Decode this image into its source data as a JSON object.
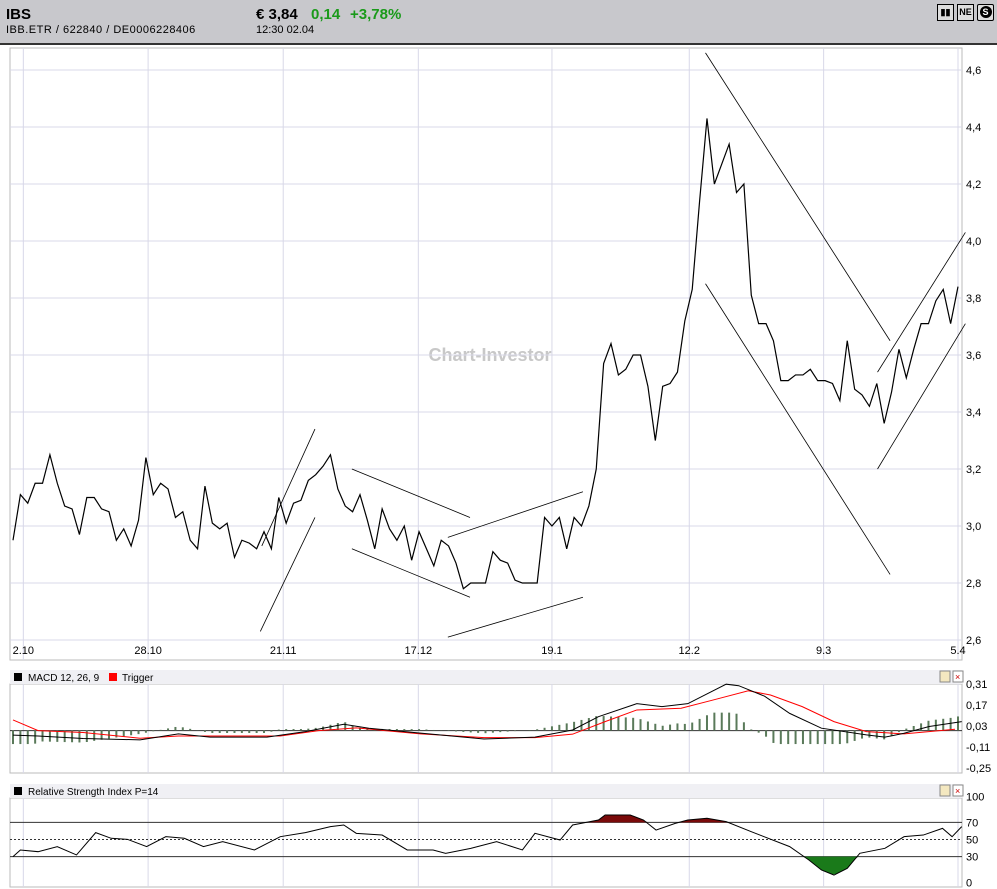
{
  "header": {
    "symbol": "IBS",
    "ids": "IBB.ETR  /  622840  /  DE0006228406",
    "price": "€ 3,84",
    "change": "0,14",
    "change_pct": "+3,78%",
    "time": "12:30   02.04",
    "icons": [
      "bar-chart-icon",
      "news-icon",
      "s-icon"
    ],
    "icon_labels": {
      "news": "NE"
    }
  },
  "watermark": "Chart-Investor",
  "chart_data": [
    {
      "type": "line",
      "title": "IBS price",
      "ylim": [
        2.6,
        4.6
      ],
      "yticks": [
        "4,6",
        "4,4",
        "4,2",
        "4,0",
        "3,8",
        "3,6",
        "3,4",
        "3,2",
        "3,0",
        "2,8",
        "2,6"
      ],
      "ytick_values": [
        4.6,
        4.4,
        4.2,
        4.0,
        3.8,
        3.6,
        3.4,
        3.2,
        3.0,
        2.8,
        2.6
      ],
      "xticks": [
        {
          "label": "2.10",
          "i": 1.4
        },
        {
          "label": "28.10",
          "i": 18.3
        },
        {
          "label": "21.11",
          "i": 36.6
        },
        {
          "label": "17.12",
          "i": 54.9
        },
        {
          "label": "19.1",
          "i": 73
        },
        {
          "label": "12.2",
          "i": 91.6
        },
        {
          "label": "9.3",
          "i": 109.8
        },
        {
          "label": "5.4",
          "i": 128
        }
      ],
      "values": [
        2.95,
        3.11,
        3.08,
        3.15,
        3.15,
        3.25,
        3.15,
        3.07,
        3.06,
        2.97,
        3.1,
        3.1,
        3.06,
        3.05,
        2.95,
        2.99,
        2.93,
        3.02,
        3.24,
        3.11,
        3.15,
        3.13,
        3.03,
        3.05,
        2.95,
        2.92,
        3.14,
        3.01,
        2.99,
        3.01,
        2.89,
        2.95,
        2.94,
        2.92,
        2.98,
        2.92,
        3.1,
        3.01,
        3.08,
        3.09,
        3.16,
        3.18,
        3.21,
        3.25,
        3.13,
        3.07,
        3.05,
        3.11,
        3.02,
        2.92,
        3.06,
        2.99,
        2.95,
        3.0,
        2.88,
        2.98,
        2.92,
        2.86,
        2.95,
        2.93,
        2.87,
        2.78,
        2.8,
        2.8,
        2.8,
        2.91,
        2.88,
        2.87,
        2.81,
        2.8,
        2.8,
        2.8,
        3.03,
        3.0,
        3.03,
        2.92,
        3.03,
        3.0,
        3.07,
        3.2,
        3.57,
        3.64,
        3.53,
        3.55,
        3.6,
        3.6,
        3.49,
        3.3,
        3.49,
        3.5,
        3.54,
        3.72,
        3.83,
        4.14,
        4.43,
        4.2,
        4.27,
        4.34,
        4.17,
        4.2,
        3.81,
        3.71,
        3.71,
        3.65,
        3.51,
        3.51,
        3.53,
        3.53,
        3.55,
        3.51,
        3.51,
        3.5,
        3.44,
        3.65,
        3.48,
        3.46,
        3.42,
        3.5,
        3.36,
        3.47,
        3.62,
        3.52,
        3.62,
        3.71,
        3.71,
        3.79,
        3.83,
        3.71,
        3.84
      ],
      "trendlines": [
        [
          33.5,
          2.63,
          40.9,
          3.03
        ],
        [
          33.7,
          2.93,
          40.9,
          3.34
        ],
        [
          45.9,
          3.2,
          61.9,
          3.03
        ],
        [
          45.9,
          2.92,
          61.9,
          2.75
        ],
        [
          58.9,
          2.96,
          77.2,
          3.12
        ],
        [
          58.9,
          2.61,
          77.2,
          2.75
        ],
        [
          93.8,
          4.66,
          118.8,
          3.65
        ],
        [
          93.8,
          3.85,
          118.8,
          2.83
        ],
        [
          117.1,
          3.54,
          129,
          4.03
        ],
        [
          117.1,
          3.2,
          129,
          3.71
        ]
      ]
    },
    {
      "type": "line",
      "title": "MACD 12, 26, 9",
      "legend": [
        "MACD 12, 26, 9",
        "Trigger"
      ],
      "ylim": [
        -0.25,
        0.31
      ],
      "yticks": [
        "0,31",
        "0,17",
        "0,03",
        "-0,11",
        "-0,25"
      ],
      "ytick_values": [
        0.31,
        0.17,
        0.03,
        -0.11,
        -0.25
      ],
      "macd": [
        [
          0,
          -0.03
        ],
        [
          3.4,
          -0.036
        ],
        [
          9.5,
          -0.053
        ],
        [
          17.2,
          -0.062
        ],
        [
          22.4,
          -0.022
        ],
        [
          26.7,
          -0.044
        ],
        [
          34.4,
          -0.044
        ],
        [
          39.6,
          -0.007
        ],
        [
          44.8,
          0.042
        ],
        [
          48.2,
          0.016
        ],
        [
          54.3,
          -0.013
        ],
        [
          63.8,
          -0.056
        ],
        [
          70.7,
          -0.044
        ],
        [
          75.8,
          0.004
        ],
        [
          79.3,
          0.093
        ],
        [
          84.5,
          0.18
        ],
        [
          87.9,
          0.16
        ],
        [
          91.4,
          0.18
        ],
        [
          96.6,
          0.31
        ],
        [
          98.3,
          0.3
        ],
        [
          101.8,
          0.23
        ],
        [
          105.2,
          0.115
        ],
        [
          109.5,
          0.016
        ],
        [
          115.6,
          -0.029
        ],
        [
          118.1,
          -0.044
        ],
        [
          120.7,
          -0.018
        ],
        [
          124.1,
          0.027
        ],
        [
          128.5,
          0.06
        ]
      ],
      "trigger": [
        [
          0,
          0.071
        ],
        [
          3.4,
          0
        ],
        [
          9.5,
          -0.013
        ],
        [
          17.2,
          -0.051
        ],
        [
          22.4,
          -0.036
        ],
        [
          29.3,
          -0.036
        ],
        [
          36.2,
          -0.036
        ],
        [
          41.4,
          0
        ],
        [
          46.5,
          0.018
        ],
        [
          55.2,
          -0.022
        ],
        [
          63.8,
          -0.047
        ],
        [
          70.7,
          -0.047
        ],
        [
          75.8,
          -0.024
        ],
        [
          80.2,
          0.06
        ],
        [
          84.5,
          0.138
        ],
        [
          90.5,
          0.149
        ],
        [
          94.8,
          0.204
        ],
        [
          99.6,
          0.266
        ],
        [
          102.6,
          0.238
        ],
        [
          106.9,
          0.16
        ],
        [
          111.2,
          0.06
        ],
        [
          115.6,
          -0.007
        ],
        [
          120.7,
          -0.022
        ],
        [
          127.6,
          0.009
        ]
      ]
    },
    {
      "type": "line",
      "title": "Relative Strength Index P=14",
      "ylim": [
        0,
        100
      ],
      "yticks": [
        "100",
        "70",
        "50",
        "30",
        "0"
      ],
      "ytick_values": [
        100,
        70,
        50,
        30,
        0
      ],
      "rsi": [
        [
          0,
          30
        ],
        [
          1,
          37.8
        ],
        [
          3.4,
          35.8
        ],
        [
          6,
          41.7
        ],
        [
          8.6,
          32
        ],
        [
          11.2,
          58
        ],
        [
          13.3,
          51.4
        ],
        [
          15.5,
          50.2
        ],
        [
          18.1,
          41.7
        ],
        [
          20.7,
          53.3
        ],
        [
          23.2,
          51.4
        ],
        [
          25.8,
          41.7
        ],
        [
          28.4,
          47.5
        ],
        [
          32.7,
          37.8
        ],
        [
          36.2,
          53.3
        ],
        [
          39.6,
          58
        ],
        [
          43,
          65
        ],
        [
          44.8,
          66.9
        ],
        [
          46.5,
          57.2
        ],
        [
          50,
          55.2
        ],
        [
          53.4,
          37.8
        ],
        [
          56.9,
          37.8
        ],
        [
          58.6,
          33.9
        ],
        [
          62,
          39.7
        ],
        [
          65.5,
          47.5
        ],
        [
          69,
          37.8
        ],
        [
          70.7,
          57.2
        ],
        [
          74.1,
          49.4
        ],
        [
          75.8,
          66.9
        ],
        [
          79.3,
          72.7
        ],
        [
          80.2,
          78.5
        ],
        [
          83.6,
          78.5
        ],
        [
          85.4,
          72.7
        ],
        [
          87.1,
          61
        ],
        [
          89.7,
          68.8
        ],
        [
          91.4,
          72.7
        ],
        [
          94,
          74.7
        ],
        [
          96.6,
          70.8
        ],
        [
          100,
          59.1
        ],
        [
          105.2,
          41.7
        ],
        [
          107.8,
          26.1
        ],
        [
          109.5,
          14.5
        ],
        [
          111.2,
          8.6
        ],
        [
          113,
          16.4
        ],
        [
          114.7,
          33.9
        ],
        [
          118.1,
          39.7
        ],
        [
          120.7,
          53.3
        ],
        [
          123.3,
          55.2
        ],
        [
          125.9,
          63
        ],
        [
          127.2,
          53.3
        ],
        [
          128.5,
          65
        ]
      ]
    }
  ],
  "colors": {
    "macd": "#000000",
    "trigger": "#ff0000",
    "hist": "#5a7a5a",
    "overbought": "#7a0a0a",
    "oversold": "#1a7a1a",
    "grid": "#d8d8e8"
  }
}
